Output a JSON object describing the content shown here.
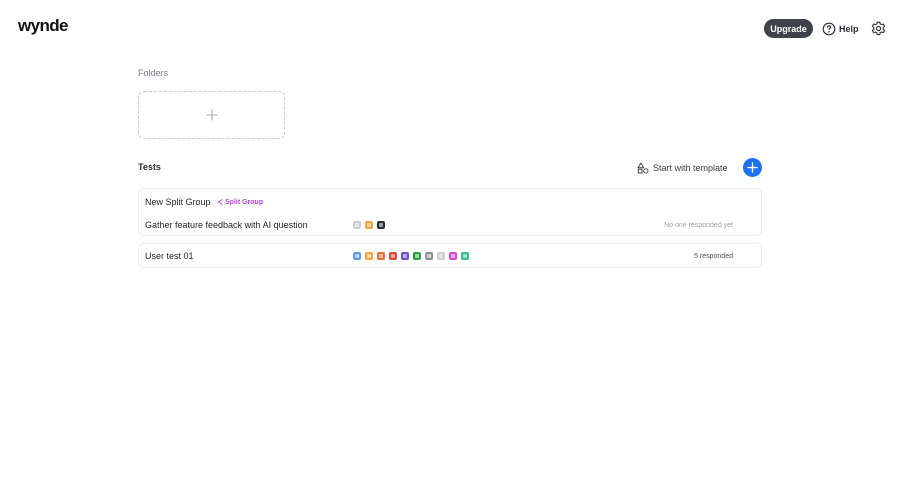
{
  "header": {
    "logo": "wynde",
    "upgrade_label": "Upgrade",
    "help_label": "Help",
    "help_icon": "question-circle-icon",
    "settings_icon": "gear-icon"
  },
  "folders": {
    "label": "Folders",
    "add_icon": "plus-icon"
  },
  "tests": {
    "label": "Tests",
    "template_label": "Start with template",
    "template_icon": "shapes-icon",
    "new_icon": "plus-icon",
    "accent": "#1f6ff5",
    "split_group": {
      "title": "New Split Group",
      "badge": "Split Group",
      "badge_color": "#b447d6",
      "tests": [
        {
          "title": "Gather feature feedback with AI question",
          "status": "No one responded yet",
          "blocks": [
            "#c9cdd3",
            "#f3a43b",
            "#2d3035"
          ]
        }
      ]
    },
    "items": [
      {
        "title": "User test 01",
        "status": "5 responded",
        "blocks": [
          "#5aa0f0",
          "#f3a43b",
          "#ee6a34",
          "#e2473a",
          "#6b4ed8",
          "#2f9e44",
          "#8e95a0",
          "#c9cdd3",
          "#d94ac9",
          "#3bbd8f"
        ]
      }
    ]
  }
}
